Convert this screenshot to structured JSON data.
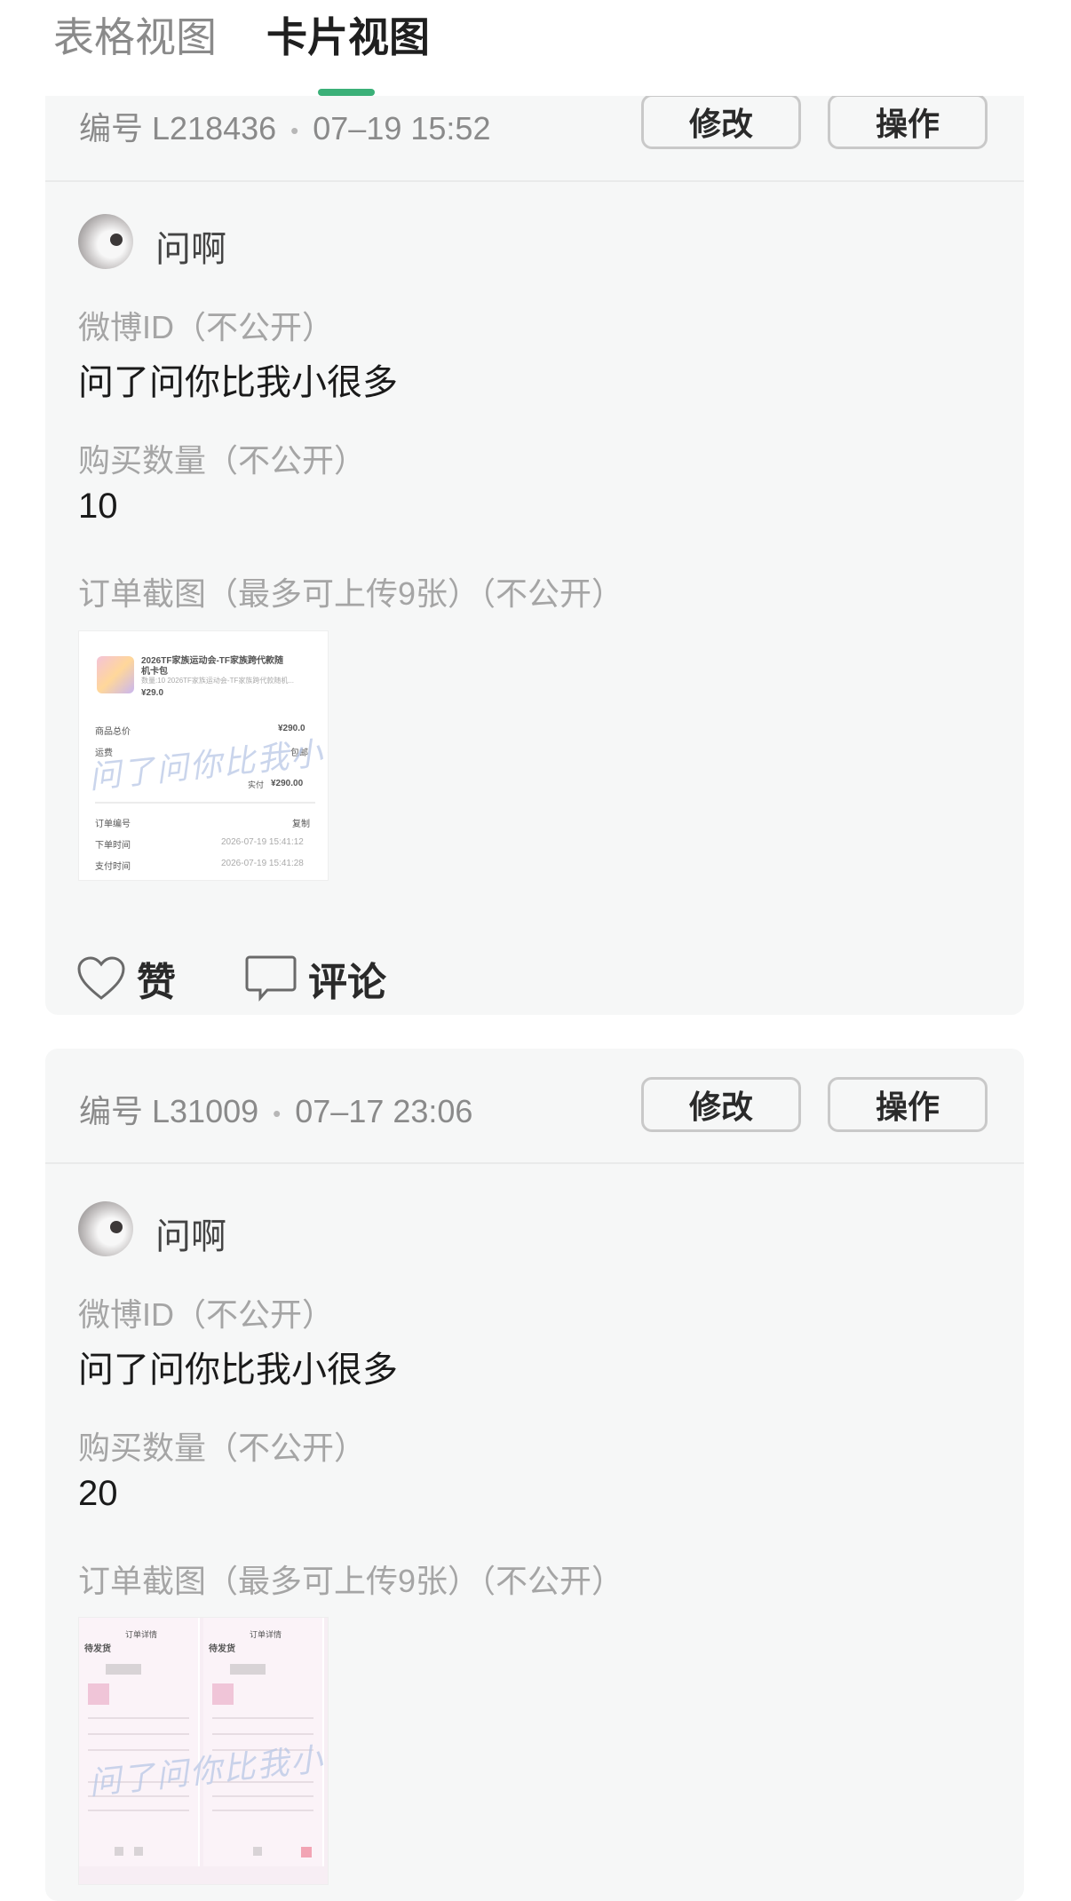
{
  "tabs": {
    "table_view": "表格视图",
    "card_view": "卡片视图"
  },
  "cards": [
    {
      "serial": "编号 L218436",
      "time": "07–19 15:52",
      "edit_label": "修改",
      "action_label": "操作",
      "username": "问啊",
      "weibo_label": "微博ID（不公开）",
      "weibo_value": "问了问你比我小很多",
      "qty_label": "购买数量（不公开）",
      "qty_value": "10",
      "screenshot_label": "订单截图（最多可上传9张）（不公开）",
      "screenshot": {
        "product_title": "2026TF家族运动会-TF家族跨代款随",
        "product_title2": "机卡包",
        "product_sub": "数量:10 2026TF家族运动会-TF家族跨代款随机...",
        "price": "¥29.0",
        "total_label": "商品总价",
        "total_value": "¥290.0",
        "shipping_label": "运费",
        "shipping_value": "包邮",
        "paid_label": "实付",
        "paid_value": "¥290.00",
        "order_no_label": "订单编号",
        "copy_label": "复制",
        "order_time_label": "下单时间",
        "order_time_value": "2026-07-19 15:41:12",
        "pay_time_label": "支付时间",
        "pay_time_value": "2026-07-19 15:41:28",
        "watermark": "问了问你比我小很多"
      },
      "like_label": "赞",
      "comment_label": "评论"
    },
    {
      "serial": "编号 L31009",
      "time": "07–17 23:06",
      "edit_label": "修改",
      "action_label": "操作",
      "username": "问啊",
      "weibo_label": "微博ID（不公开）",
      "weibo_value": "问了问你比我小很多",
      "qty_label": "购买数量（不公开）",
      "qty_value": "20",
      "screenshot_label": "订单截图（最多可上传9张）（不公开）",
      "screenshot": {
        "header_left": "订单详情",
        "header_right": "订单详情",
        "status_left": "待发货",
        "status_right": "待发货",
        "watermark": "问了问你比我小很多"
      }
    }
  ]
}
